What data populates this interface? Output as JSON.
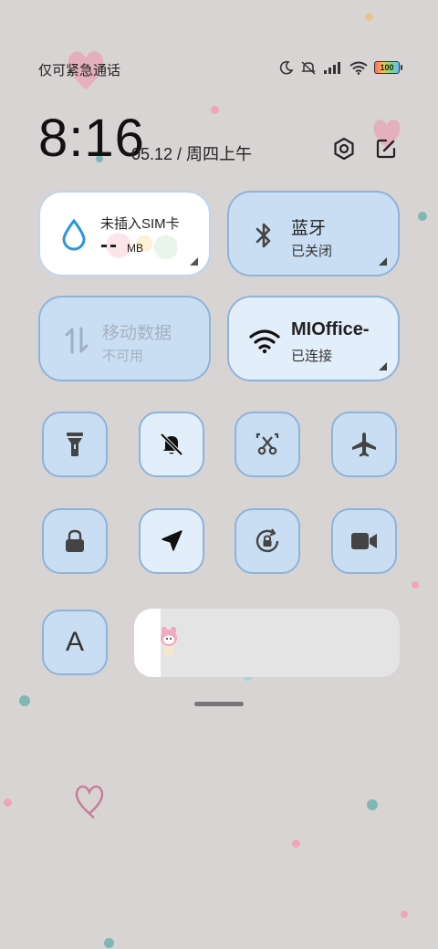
{
  "status_bar": {
    "carrier_text": "仅可紧急通话",
    "battery_text": "100"
  },
  "clock": {
    "time": "8:16",
    "date": "05.12 / 周四上午"
  },
  "tiles": {
    "sim": {
      "title": "未插入SIM卡",
      "value": "--",
      "unit": "MB"
    },
    "bluetooth": {
      "title": "蓝牙",
      "status": "已关闭"
    },
    "mobile_data": {
      "title": "移动数据",
      "status": "不可用"
    },
    "wifi": {
      "title": "MIOffice-",
      "status": "已连接"
    }
  },
  "quick_toggles": [
    {
      "name": "flashlight",
      "icon": "flashlight-icon",
      "state": "off"
    },
    {
      "name": "mute",
      "icon": "bell-off-icon",
      "state": "on"
    },
    {
      "name": "screenshot",
      "icon": "scissors-icon",
      "state": "off"
    },
    {
      "name": "airplane",
      "icon": "airplane-icon",
      "state": "off"
    },
    {
      "name": "lock",
      "icon": "lock-icon",
      "state": "off"
    },
    {
      "name": "location",
      "icon": "location-icon",
      "state": "on"
    },
    {
      "name": "rotation-lock",
      "icon": "rotation-lock-icon",
      "state": "off"
    },
    {
      "name": "screen-record",
      "icon": "video-camera-icon",
      "state": "off"
    }
  ],
  "font_button": {
    "label": "A"
  },
  "brightness": {
    "level": 0.1
  },
  "colors": {
    "background": "#d8d4d4",
    "tile_active": "#c9def3",
    "tile_light": "#e2eef9",
    "tile_border": "#8fb3d9",
    "icon": "#333333"
  }
}
